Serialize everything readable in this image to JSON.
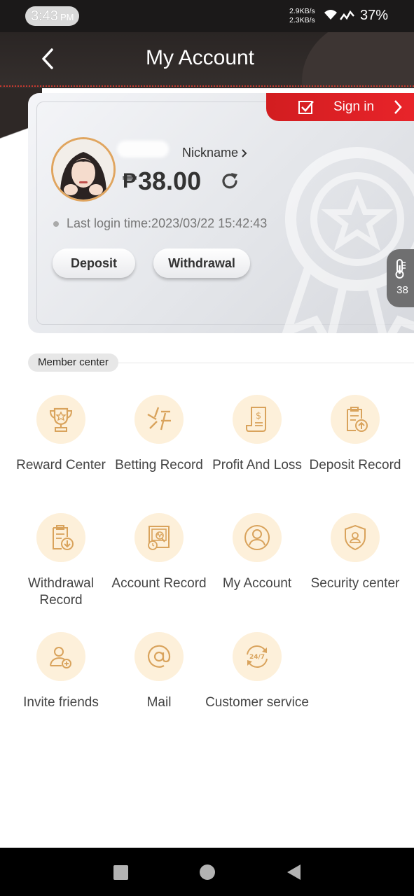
{
  "status_bar": {
    "time": "3:43",
    "ampm": "PM",
    "net_speed_up": "2.9KB/s",
    "net_speed_down": "2.3KB/s",
    "battery": "37%"
  },
  "header": {
    "title": "My Account",
    "back_icon": "chevron-left-icon"
  },
  "card": {
    "signin_label": "Sign in",
    "nickname": "Nickname",
    "currency_symbol": "₱",
    "balance": "38.00",
    "last_login": "Last login time:2023/03/22 15:42:43",
    "deposit_label": "Deposit",
    "withdrawal_label": "Withdrawal",
    "side_value": "38"
  },
  "member_center": {
    "title": "Member center",
    "items": [
      {
        "label": "Reward Center",
        "icon": "trophy-icon"
      },
      {
        "label": "Betting Record",
        "icon": "betting-icon"
      },
      {
        "label": "Profit And Loss",
        "icon": "receipt-icon"
      },
      {
        "label": "Deposit Record",
        "icon": "clipboard-upload-icon"
      },
      {
        "label": "Withdrawal Record",
        "icon": "clipboard-download-icon"
      },
      {
        "label": "Account Record",
        "icon": "monitor-clock-icon"
      },
      {
        "label": "My Account",
        "icon": "user-circle-icon"
      },
      {
        "label": "Security center",
        "icon": "shield-user-icon"
      },
      {
        "label": "Invite friends",
        "icon": "user-add-icon"
      },
      {
        "label": "Mail",
        "icon": "at-icon"
      },
      {
        "label": "Customer service",
        "icon": "support-24-7-icon"
      }
    ]
  },
  "colors": {
    "header_bg": "#2a2524",
    "signin_red": "#e0222a",
    "icon_gold": "#d9a35c",
    "icon_circle": "#fdf0da"
  }
}
